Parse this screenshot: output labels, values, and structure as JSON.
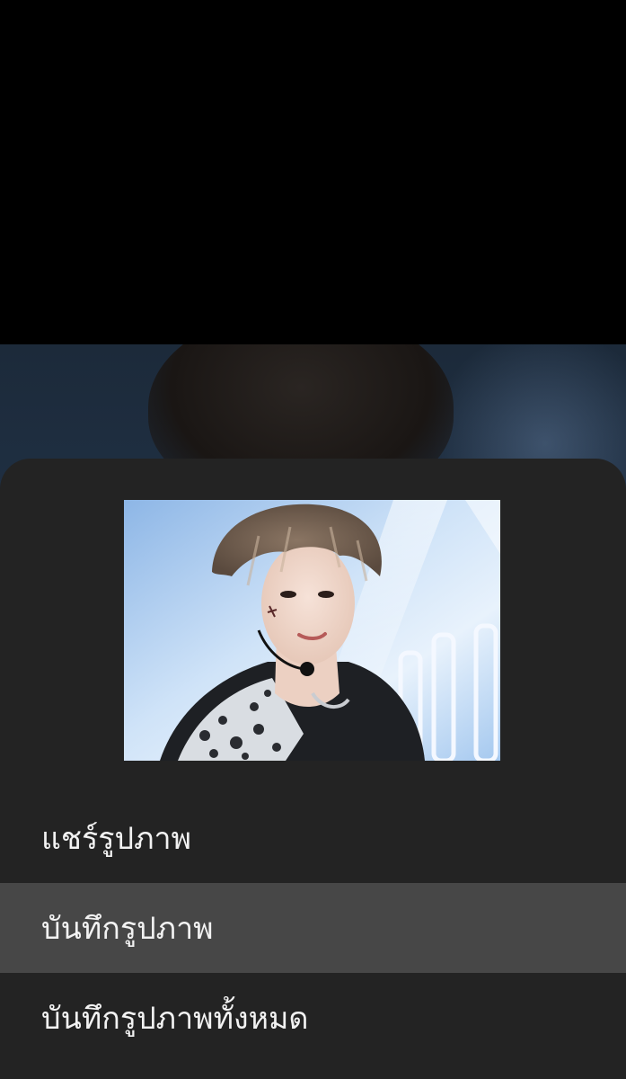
{
  "menu": {
    "items": [
      {
        "label": "แชร์รูปภาพ",
        "selected": false
      },
      {
        "label": "บันทึกรูปภาพ",
        "selected": true
      },
      {
        "label": "บันทึกรูปภาพทั้งหมด",
        "selected": false
      }
    ]
  },
  "colors": {
    "sheet_background": "#232323",
    "selected_item_background": "#474747",
    "text": "#f2f2f2",
    "backdrop": "#000000"
  }
}
